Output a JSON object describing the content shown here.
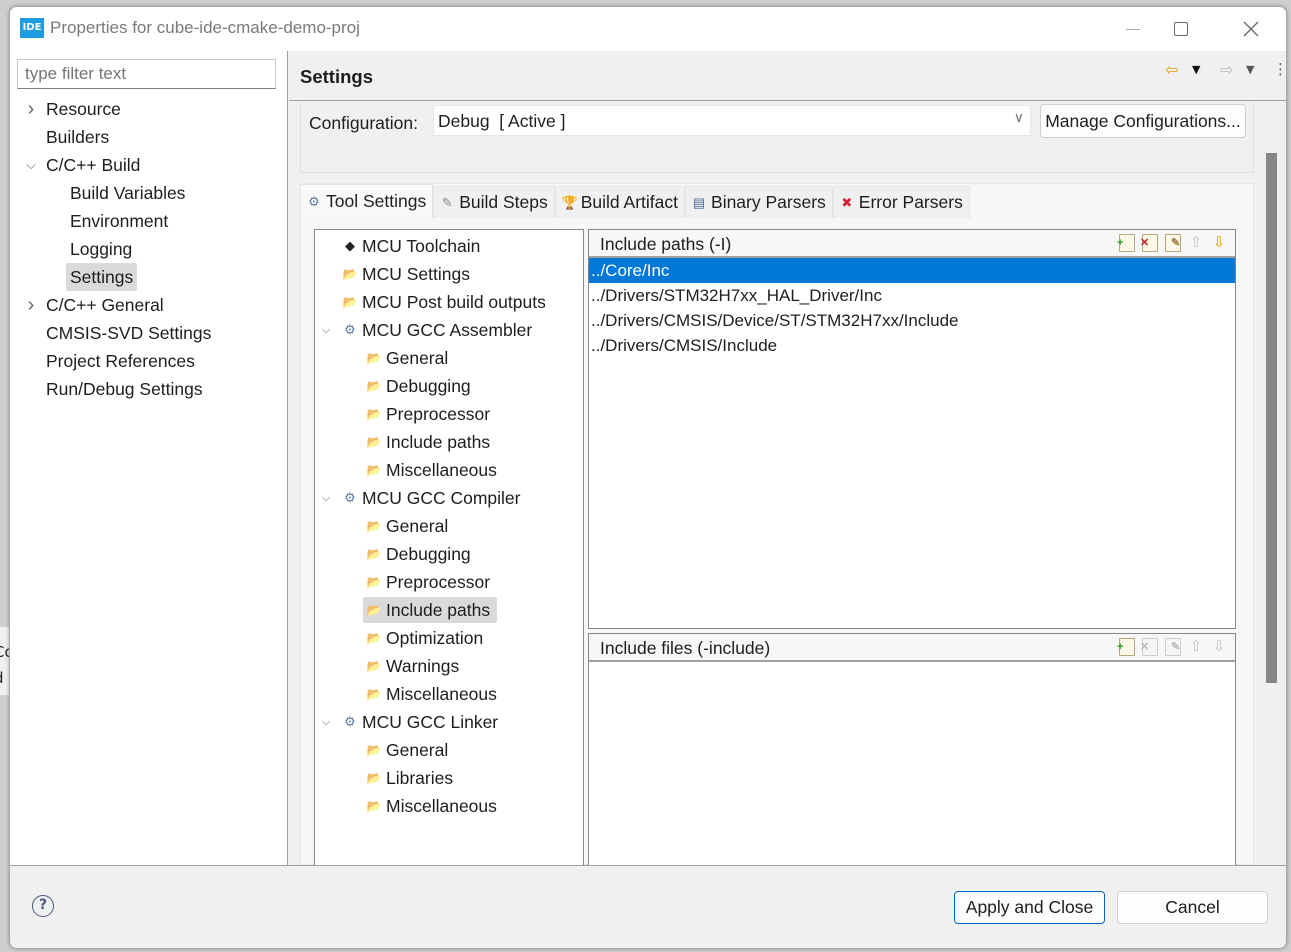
{
  "window": {
    "app_icon": "IDE",
    "title": "Properties for cube-ide-cmake-demo-proj"
  },
  "background_fragments": [
    "Co",
    "d"
  ],
  "left": {
    "filter_placeholder": "type filter text",
    "tree": [
      {
        "label": "Resource",
        "level": 0,
        "twisty": "collapsed"
      },
      {
        "label": "Builders",
        "level": 0,
        "twisty": "none"
      },
      {
        "label": "C/C++ Build",
        "level": 0,
        "twisty": "expanded"
      },
      {
        "label": "Build Variables",
        "level": 1,
        "twisty": "none"
      },
      {
        "label": "Environment",
        "level": 1,
        "twisty": "none"
      },
      {
        "label": "Logging",
        "level": 1,
        "twisty": "none"
      },
      {
        "label": "Settings",
        "level": 1,
        "twisty": "none",
        "selected": true
      },
      {
        "label": "C/C++ General",
        "level": 0,
        "twisty": "collapsed"
      },
      {
        "label": "CMSIS-SVD Settings",
        "level": 0,
        "twisty": "none"
      },
      {
        "label": "Project References",
        "level": 0,
        "twisty": "none"
      },
      {
        "label": "Run/Debug Settings",
        "level": 0,
        "twisty": "none"
      }
    ]
  },
  "header": {
    "title": "Settings",
    "back_icon": "⇦",
    "forward_icon": "⇨",
    "menu_icon": "⋮"
  },
  "config": {
    "label": "Configuration:",
    "value": "Debug  [ Active ]",
    "manage_label": "Manage Configurations..."
  },
  "tabs": [
    {
      "label": "Tool Settings",
      "icon": "tool-settings-icon",
      "glyph": "⚙",
      "color": "#5a7a9a",
      "active": true
    },
    {
      "label": "Build Steps",
      "icon": "build-steps-icon",
      "glyph": "✎",
      "color": "#8a8a8a",
      "active": false
    },
    {
      "label": "Build Artifact",
      "icon": "build-artifact-icon",
      "glyph": "🏆",
      "color": "#e0a800",
      "active": false
    },
    {
      "label": "Binary Parsers",
      "icon": "binary-parsers-icon",
      "glyph": "▤",
      "color": "#4a6a9a",
      "active": false
    },
    {
      "label": "Error Parsers",
      "icon": "error-parsers-icon",
      "glyph": "✖",
      "color": "#d0243a",
      "active": false
    }
  ],
  "tool_tree": [
    {
      "label": "MCU Toolchain",
      "level": 0,
      "icon": "chip",
      "twisty": "none"
    },
    {
      "label": "MCU Settings",
      "level": 0,
      "icon": "folder-option",
      "twisty": "none"
    },
    {
      "label": "MCU Post build outputs",
      "level": 0,
      "icon": "folder-option",
      "twisty": "none"
    },
    {
      "label": "MCU GCC Assembler",
      "level": 0,
      "icon": "tool",
      "twisty": "expanded"
    },
    {
      "label": "General",
      "level": 1,
      "icon": "folder-option",
      "twisty": "none"
    },
    {
      "label": "Debugging",
      "level": 1,
      "icon": "folder-option",
      "twisty": "none"
    },
    {
      "label": "Preprocessor",
      "level": 1,
      "icon": "folder-option",
      "twisty": "none"
    },
    {
      "label": "Include paths",
      "level": 1,
      "icon": "folder-option",
      "twisty": "none"
    },
    {
      "label": "Miscellaneous",
      "level": 1,
      "icon": "folder-option",
      "twisty": "none"
    },
    {
      "label": "MCU GCC Compiler",
      "level": 0,
      "icon": "tool",
      "twisty": "expanded"
    },
    {
      "label": "General",
      "level": 1,
      "icon": "folder-option",
      "twisty": "none"
    },
    {
      "label": "Debugging",
      "level": 1,
      "icon": "folder-option",
      "twisty": "none"
    },
    {
      "label": "Preprocessor",
      "level": 1,
      "icon": "folder-option",
      "twisty": "none"
    },
    {
      "label": "Include paths",
      "level": 1,
      "icon": "folder-option",
      "twisty": "none",
      "selected": true
    },
    {
      "label": "Optimization",
      "level": 1,
      "icon": "folder-option",
      "twisty": "none"
    },
    {
      "label": "Warnings",
      "level": 1,
      "icon": "folder-option",
      "twisty": "none"
    },
    {
      "label": "Miscellaneous",
      "level": 1,
      "icon": "folder-option",
      "twisty": "none"
    },
    {
      "label": "MCU GCC Linker",
      "level": 0,
      "icon": "tool",
      "twisty": "expanded"
    },
    {
      "label": "General",
      "level": 1,
      "icon": "folder-option",
      "twisty": "none"
    },
    {
      "label": "Libraries",
      "level": 1,
      "icon": "folder-option",
      "twisty": "none"
    },
    {
      "label": "Miscellaneous",
      "level": 1,
      "icon": "folder-option",
      "twisty": "none"
    }
  ],
  "include_paths": {
    "title": "Include paths (-I)",
    "tools": [
      {
        "name": "add-icon",
        "enabled": true
      },
      {
        "name": "delete-icon",
        "enabled": true
      },
      {
        "name": "edit-icon",
        "enabled": true
      },
      {
        "name": "move-up-icon",
        "enabled": false
      },
      {
        "name": "move-down-icon",
        "enabled": true
      }
    ],
    "items": [
      {
        "value": "../Core/Inc",
        "selected": true
      },
      {
        "value": "../Drivers/STM32H7xx_HAL_Driver/Inc",
        "selected": false
      },
      {
        "value": "../Drivers/CMSIS/Device/ST/STM32H7xx/Include",
        "selected": false
      },
      {
        "value": "../Drivers/CMSIS/Include",
        "selected": false
      }
    ]
  },
  "include_files": {
    "title": "Include files (-include)",
    "tools": [
      {
        "name": "add-icon",
        "enabled": true
      },
      {
        "name": "delete-icon",
        "enabled": false
      },
      {
        "name": "edit-icon",
        "enabled": false
      },
      {
        "name": "move-up-icon",
        "enabled": false
      },
      {
        "name": "move-down-icon",
        "enabled": false
      }
    ],
    "items": []
  },
  "footer": {
    "help_glyph": "?",
    "apply_close_label": "Apply and Close",
    "cancel_label": "Cancel"
  },
  "colors": {
    "selection": "#0078d7",
    "app_icon_bg": "#1f9de3",
    "tree_selection": "#dadada"
  }
}
